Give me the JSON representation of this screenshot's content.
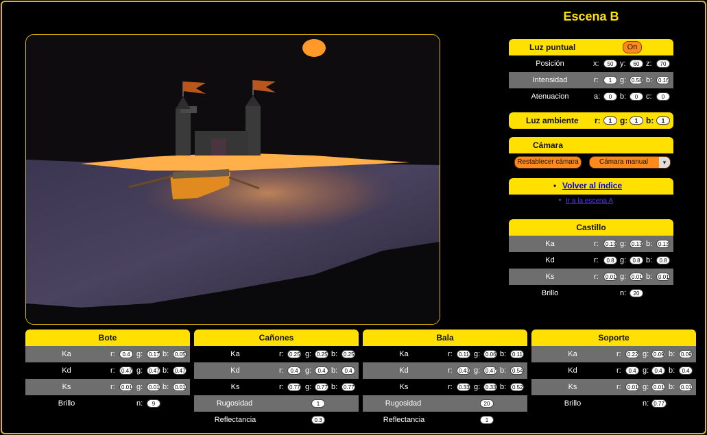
{
  "page": {
    "title": "Escena B"
  },
  "luz_puntual": {
    "title": "Luz puntual",
    "toggle": "On",
    "posicion": {
      "label": "Posición",
      "x": "50",
      "y": "60",
      "z": "70"
    },
    "intensidad": {
      "label": "Intensidad",
      "r": "1",
      "g": "0.58",
      "b": "0.16"
    },
    "atenuacion": {
      "label": "Atenuacion",
      "a": "0",
      "b": "0",
      "c": "0"
    }
  },
  "luz_ambiente": {
    "title": "Luz ambiente",
    "r": "1",
    "g": "1",
    "b": "1"
  },
  "camara": {
    "title": "Cámara",
    "reset_label": "Restablecer cámara",
    "mode": "Cámara manual"
  },
  "nav": {
    "back": "Volver al índice",
    "scene_a": "Ir a la escena A"
  },
  "labels": {
    "r": "r:",
    "g": "g:",
    "b": "b:",
    "x": "x:",
    "y": "y:",
    "z": "z:",
    "a": "a:",
    "c": "c:",
    "n": "n:"
  },
  "castillo": {
    "title": "Castillo",
    "ka": {
      "label": "Ka",
      "r": "0.13",
      "g": "0.13",
      "b": "0.13"
    },
    "kd": {
      "label": "Kd",
      "r": "0.8",
      "g": "0.8",
      "b": "0.8"
    },
    "ks": {
      "label": "Ks",
      "r": "0.01",
      "g": "0.01",
      "b": "0.01"
    },
    "brillo": {
      "label": "Brillo",
      "n": "20"
    }
  },
  "bote": {
    "title": "Bote",
    "ka": {
      "label": "Ka",
      "r": "0.4",
      "g": "0.17",
      "b": "0.05"
    },
    "kd": {
      "label": "Kd",
      "r": "0.47",
      "g": "0.47",
      "b": "0.47"
    },
    "ks": {
      "label": "Ks",
      "r": "0.01",
      "g": "0.01",
      "b": "0.01"
    },
    "brillo": {
      "label": "Brillo",
      "n": "9"
    }
  },
  "canones": {
    "title": "Cañones",
    "ka": {
      "label": "Ka",
      "r": "0.25",
      "g": "0.25",
      "b": "0.25"
    },
    "kd": {
      "label": "Kd",
      "r": "0.4",
      "g": "0.4",
      "b": "0.4"
    },
    "ks": {
      "label": "Ks",
      "r": "0.77",
      "g": "0.77",
      "b": "0.77"
    },
    "rugosidad": {
      "label": "Rugosidad",
      "value": "1"
    },
    "reflectancia": {
      "label": "Reflectancia",
      "value": "0.3"
    }
  },
  "bala": {
    "title": "Bala",
    "ka": {
      "label": "Ka",
      "r": "0.11",
      "g": "0.06",
      "b": "0.11"
    },
    "kd": {
      "label": "Kd",
      "r": "0.43",
      "g": "0.47",
      "b": "0.54"
    },
    "ks": {
      "label": "Ks",
      "r": "0.33",
      "g": "0.33",
      "b": "0.52"
    },
    "rugosidad": {
      "label": "Rugosidad",
      "value": "20"
    },
    "reflectancia": {
      "label": "Reflectancia",
      "value": "1"
    }
  },
  "soporte": {
    "title": "Soporte",
    "ka": {
      "label": "Ka",
      "r": "0.22",
      "g": "0.09",
      "b": "0.09"
    },
    "kd": {
      "label": "Kd",
      "r": "0.4",
      "g": "0.4",
      "b": "0.4"
    },
    "ks": {
      "label": "Ks",
      "r": "0.01",
      "g": "0.01",
      "b": "0.01"
    },
    "brillo": {
      "label": "Brillo",
      "n": "0.77"
    }
  },
  "colors": {
    "accent": "#ffe000",
    "button": "#ff8a1a",
    "row_grey": "#6e6e6e",
    "frame": "#e6b800"
  }
}
